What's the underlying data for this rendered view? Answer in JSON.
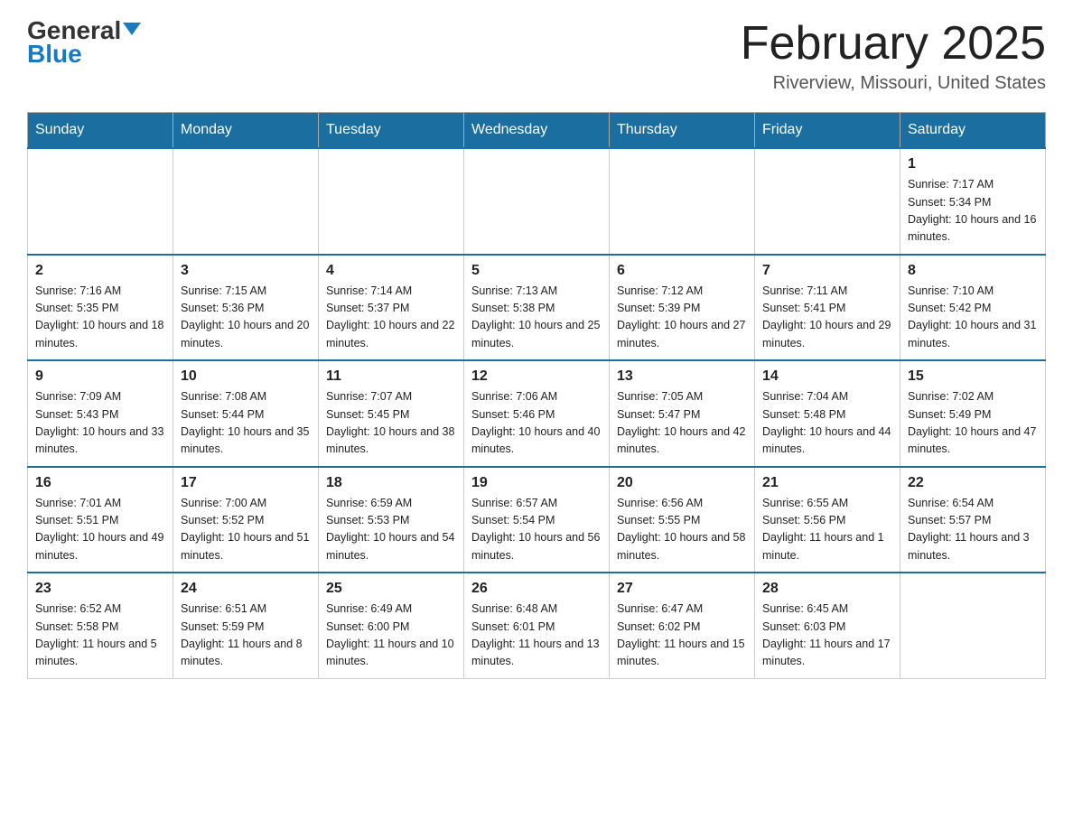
{
  "header": {
    "logo_general": "General",
    "logo_blue": "Blue",
    "month_title": "February 2025",
    "location": "Riverview, Missouri, United States"
  },
  "days_of_week": [
    "Sunday",
    "Monday",
    "Tuesday",
    "Wednesday",
    "Thursday",
    "Friday",
    "Saturday"
  ],
  "weeks": [
    [
      {
        "day": "",
        "empty": true
      },
      {
        "day": "",
        "empty": true
      },
      {
        "day": "",
        "empty": true
      },
      {
        "day": "",
        "empty": true
      },
      {
        "day": "",
        "empty": true
      },
      {
        "day": "",
        "empty": true
      },
      {
        "day": "1",
        "sunrise": "Sunrise: 7:17 AM",
        "sunset": "Sunset: 5:34 PM",
        "daylight": "Daylight: 10 hours and 16 minutes."
      }
    ],
    [
      {
        "day": "2",
        "sunrise": "Sunrise: 7:16 AM",
        "sunset": "Sunset: 5:35 PM",
        "daylight": "Daylight: 10 hours and 18 minutes."
      },
      {
        "day": "3",
        "sunrise": "Sunrise: 7:15 AM",
        "sunset": "Sunset: 5:36 PM",
        "daylight": "Daylight: 10 hours and 20 minutes."
      },
      {
        "day": "4",
        "sunrise": "Sunrise: 7:14 AM",
        "sunset": "Sunset: 5:37 PM",
        "daylight": "Daylight: 10 hours and 22 minutes."
      },
      {
        "day": "5",
        "sunrise": "Sunrise: 7:13 AM",
        "sunset": "Sunset: 5:38 PM",
        "daylight": "Daylight: 10 hours and 25 minutes."
      },
      {
        "day": "6",
        "sunrise": "Sunrise: 7:12 AM",
        "sunset": "Sunset: 5:39 PM",
        "daylight": "Daylight: 10 hours and 27 minutes."
      },
      {
        "day": "7",
        "sunrise": "Sunrise: 7:11 AM",
        "sunset": "Sunset: 5:41 PM",
        "daylight": "Daylight: 10 hours and 29 minutes."
      },
      {
        "day": "8",
        "sunrise": "Sunrise: 7:10 AM",
        "sunset": "Sunset: 5:42 PM",
        "daylight": "Daylight: 10 hours and 31 minutes."
      }
    ],
    [
      {
        "day": "9",
        "sunrise": "Sunrise: 7:09 AM",
        "sunset": "Sunset: 5:43 PM",
        "daylight": "Daylight: 10 hours and 33 minutes."
      },
      {
        "day": "10",
        "sunrise": "Sunrise: 7:08 AM",
        "sunset": "Sunset: 5:44 PM",
        "daylight": "Daylight: 10 hours and 35 minutes."
      },
      {
        "day": "11",
        "sunrise": "Sunrise: 7:07 AM",
        "sunset": "Sunset: 5:45 PM",
        "daylight": "Daylight: 10 hours and 38 minutes."
      },
      {
        "day": "12",
        "sunrise": "Sunrise: 7:06 AM",
        "sunset": "Sunset: 5:46 PM",
        "daylight": "Daylight: 10 hours and 40 minutes."
      },
      {
        "day": "13",
        "sunrise": "Sunrise: 7:05 AM",
        "sunset": "Sunset: 5:47 PM",
        "daylight": "Daylight: 10 hours and 42 minutes."
      },
      {
        "day": "14",
        "sunrise": "Sunrise: 7:04 AM",
        "sunset": "Sunset: 5:48 PM",
        "daylight": "Daylight: 10 hours and 44 minutes."
      },
      {
        "day": "15",
        "sunrise": "Sunrise: 7:02 AM",
        "sunset": "Sunset: 5:49 PM",
        "daylight": "Daylight: 10 hours and 47 minutes."
      }
    ],
    [
      {
        "day": "16",
        "sunrise": "Sunrise: 7:01 AM",
        "sunset": "Sunset: 5:51 PM",
        "daylight": "Daylight: 10 hours and 49 minutes."
      },
      {
        "day": "17",
        "sunrise": "Sunrise: 7:00 AM",
        "sunset": "Sunset: 5:52 PM",
        "daylight": "Daylight: 10 hours and 51 minutes."
      },
      {
        "day": "18",
        "sunrise": "Sunrise: 6:59 AM",
        "sunset": "Sunset: 5:53 PM",
        "daylight": "Daylight: 10 hours and 54 minutes."
      },
      {
        "day": "19",
        "sunrise": "Sunrise: 6:57 AM",
        "sunset": "Sunset: 5:54 PM",
        "daylight": "Daylight: 10 hours and 56 minutes."
      },
      {
        "day": "20",
        "sunrise": "Sunrise: 6:56 AM",
        "sunset": "Sunset: 5:55 PM",
        "daylight": "Daylight: 10 hours and 58 minutes."
      },
      {
        "day": "21",
        "sunrise": "Sunrise: 6:55 AM",
        "sunset": "Sunset: 5:56 PM",
        "daylight": "Daylight: 11 hours and 1 minute."
      },
      {
        "day": "22",
        "sunrise": "Sunrise: 6:54 AM",
        "sunset": "Sunset: 5:57 PM",
        "daylight": "Daylight: 11 hours and 3 minutes."
      }
    ],
    [
      {
        "day": "23",
        "sunrise": "Sunrise: 6:52 AM",
        "sunset": "Sunset: 5:58 PM",
        "daylight": "Daylight: 11 hours and 5 minutes."
      },
      {
        "day": "24",
        "sunrise": "Sunrise: 6:51 AM",
        "sunset": "Sunset: 5:59 PM",
        "daylight": "Daylight: 11 hours and 8 minutes."
      },
      {
        "day": "25",
        "sunrise": "Sunrise: 6:49 AM",
        "sunset": "Sunset: 6:00 PM",
        "daylight": "Daylight: 11 hours and 10 minutes."
      },
      {
        "day": "26",
        "sunrise": "Sunrise: 6:48 AM",
        "sunset": "Sunset: 6:01 PM",
        "daylight": "Daylight: 11 hours and 13 minutes."
      },
      {
        "day": "27",
        "sunrise": "Sunrise: 6:47 AM",
        "sunset": "Sunset: 6:02 PM",
        "daylight": "Daylight: 11 hours and 15 minutes."
      },
      {
        "day": "28",
        "sunrise": "Sunrise: 6:45 AM",
        "sunset": "Sunset: 6:03 PM",
        "daylight": "Daylight: 11 hours and 17 minutes."
      },
      {
        "day": "",
        "empty": true
      }
    ]
  ]
}
